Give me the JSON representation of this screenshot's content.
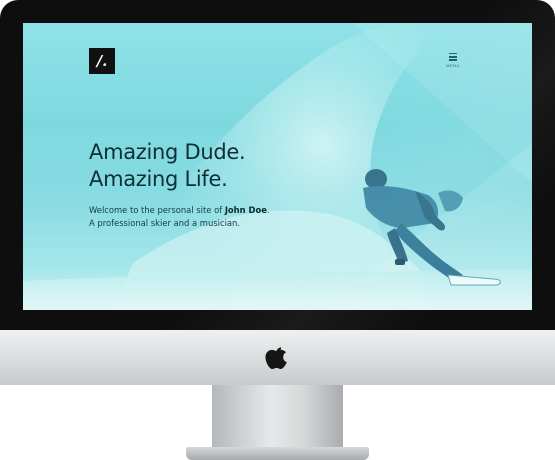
{
  "device": {
    "type": "desktop monitor mockup",
    "logo_icon": "apple-logo-icon"
  },
  "site": {
    "logo_text": "/.",
    "menu_label": "MENU",
    "menu_icon": "hamburger-icon",
    "hero": {
      "title_line1": "Amazing Dude.",
      "title_line2": "Amazing Life.",
      "intro_prefix": "Welcome to the personal site of ",
      "intro_name": "John Doe",
      "intro_suffix": ".",
      "intro_line2": "A professional skier and a musician."
    },
    "background": "snowboarder carving through powder snow",
    "colors": {
      "screen_tint": "#87dbe2",
      "heading": "#0d2f36",
      "logo_bg": "#111111",
      "bezel": "#0e0e0e",
      "chin": "#e2e4e5"
    }
  }
}
